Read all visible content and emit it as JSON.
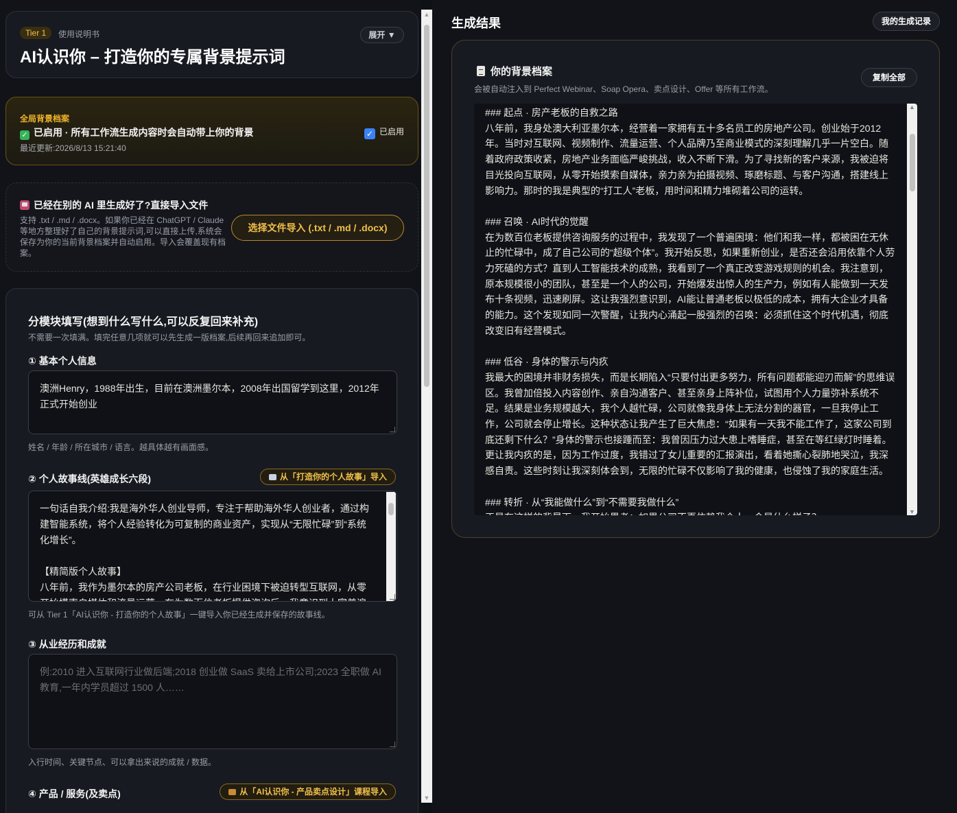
{
  "header": {
    "tier": "Tier 1",
    "manual_label": "使用说明书",
    "expand_label": "展开 ▼",
    "title": "AI认识你 – 打造你的专属背景提示词"
  },
  "global_profile": {
    "title": "全局背景档案",
    "status": "已启用 · 所有工作流生成内容时会自动带上你的背景",
    "updated": "最近更新:2026/8/13 15:21:40",
    "toggle_label": "已启用",
    "toggle_checked": true
  },
  "import_section": {
    "title": "已经在别的 AI 里生成好了?直接导入文件",
    "description": "支持 .txt / .md / .docx。如果你已经在 ChatGPT / Claude 等地方整理好了自己的背景提示词,可以直接上传,系统会保存为你的当前背景档案并自动启用。导入会覆盖现有档案。",
    "button": "选择文件导入 (.txt / .md / .docx)"
  },
  "form": {
    "title": "分模块填写(想到什么写什么,可以反复回来补充)",
    "subtitle": "不需要一次填满。填完任意几项就可以先生成一版档案,后续再回来追加即可。",
    "basic_info": {
      "label": "① 基本个人信息",
      "value": "澳洲Henry，1988年出生，目前在澳洲墨尔本，2008年出国留学到这里，2012年正式开始创业",
      "hint": "姓名 / 年龄 / 所在城市 / 语言。越具体越有画面感。"
    },
    "story": {
      "label": "② 个人故事线(英雄成长六段)",
      "import_label": "从「打造你的个人故事」导入",
      "value": "一句话自我介绍:我是海外华人创业导师，专注于帮助海外华人创业者，通过构建智能系统，将个人经验转化为可复制的商业资产，实现从“无限忙碌”到“系统化增长”。\n\n【精简版个人故事】\n八年前，我作为墨尔本的房产公司老板，在行业困境下被迫转型互联网，从零开始摸索自媒体和流量运营。在为数百位老板提供咨询后，我意识到大家普遍",
      "hint": "可从 Tier 1「AI认识你 - 打造你的个人故事」一键导入你已经生成并保存的故事线。"
    },
    "career": {
      "label": "③ 从业经历和成就",
      "placeholder": "例:2010 进入互联网行业做后端;2018 创业做 SaaS 卖给上市公司;2023 全职做 AI 教育,一年内学员超过 1500 人……",
      "hint": "入行时间、关键节点、可以拿出来说的成就 / 数据。"
    },
    "product": {
      "label": "④ 产品 / 服务(及卖点)",
      "import_label": "从「AI认识你 - 产品卖点设计」课程导入"
    }
  },
  "result": {
    "heading": "生成结果",
    "history_button": "我的生成记录",
    "doc_title": "你的背景档案",
    "doc_subtitle": "会被自动注入到 Perfect Webinar、Soap Opera、卖点设计、Offer 等所有工作流。",
    "copy_button": "复制全部",
    "content": "### 起点 · 房产老板的自救之路\n八年前，我身处澳大利亚墨尔本，经营着一家拥有五十多名员工的房地产公司。创业始于2012年。当时对互联网、视频制作、流量运营、个人品牌乃至商业模式的深刻理解几乎一片空白。随着政府政策收紧，房地产业务面临严峻挑战，收入不断下滑。为了寻找新的客户来源，我被迫将目光投向互联网，从零开始摸索自媒体，亲力亲为拍摄视频、琢磨标题、与客户沟通，搭建线上影响力。那时的我是典型的“打工人”老板，用时间和精力堆砌着公司的运转。\n\n### 召唤 · AI时代的觉醒\n在为数百位老板提供咨询服务的过程中，我发现了一个普遍困境：他们和我一样，都被困在无休止的忙碌中，成了自己公司的“超级个体”。我开始反思，如果重新创业，是否还会沿用依靠个人劳力死磕的方式？直到人工智能技术的成熟，我看到了一个真正改变游戏规则的机会。我注意到，原本规模很小的团队，甚至是一个人的公司，开始爆发出惊人的生产力，例如有人能做到一天发布十条视频，迅速刷屏。这让我强烈意识到，AI能让普通老板以极低的成本，拥有大企业才具备的能力。这个发现如同一次警醒，让我内心涌起一股强烈的召唤：必须抓住这个时代机遇，彻底改变旧有经营模式。\n\n### 低谷 · 身体的警示与内疚\n我最大的困境并非财务损失，而是长期陷入“只要付出更多努力，所有问题都能迎刃而解”的思维误区。我曾加倍投入内容创作、亲自沟通客户、甚至亲身上阵补位，试图用个人力量弥补系统不足。结果是业务规模越大，我个人越忙碌，公司就像我身体上无法分割的器官，一旦我停止工作，公司就会停止增长。这种状态让我产生了巨大焦虑：“如果有一天我不能工作了，这家公司到底还剩下什么？”身体的警示也接踵而至：我曾因压力过大患上嗜睡症，甚至在等红绿灯时睡着。更让我内疚的是，因为工作过度，我错过了女儿重要的汇报演出，看着她撕心裂肺地哭泣，我深感自责。这些时刻让我深刻体会到，无限的忙碌不仅影响了我的健康，也侵蚀了我的家庭生活。\n\n### 转折 · 从“我能做什么”到“不需要我做什么”\n正是在这样的背景下，我开始思考：如果公司不再依赖我个人，会是什么样子？"
  }
}
